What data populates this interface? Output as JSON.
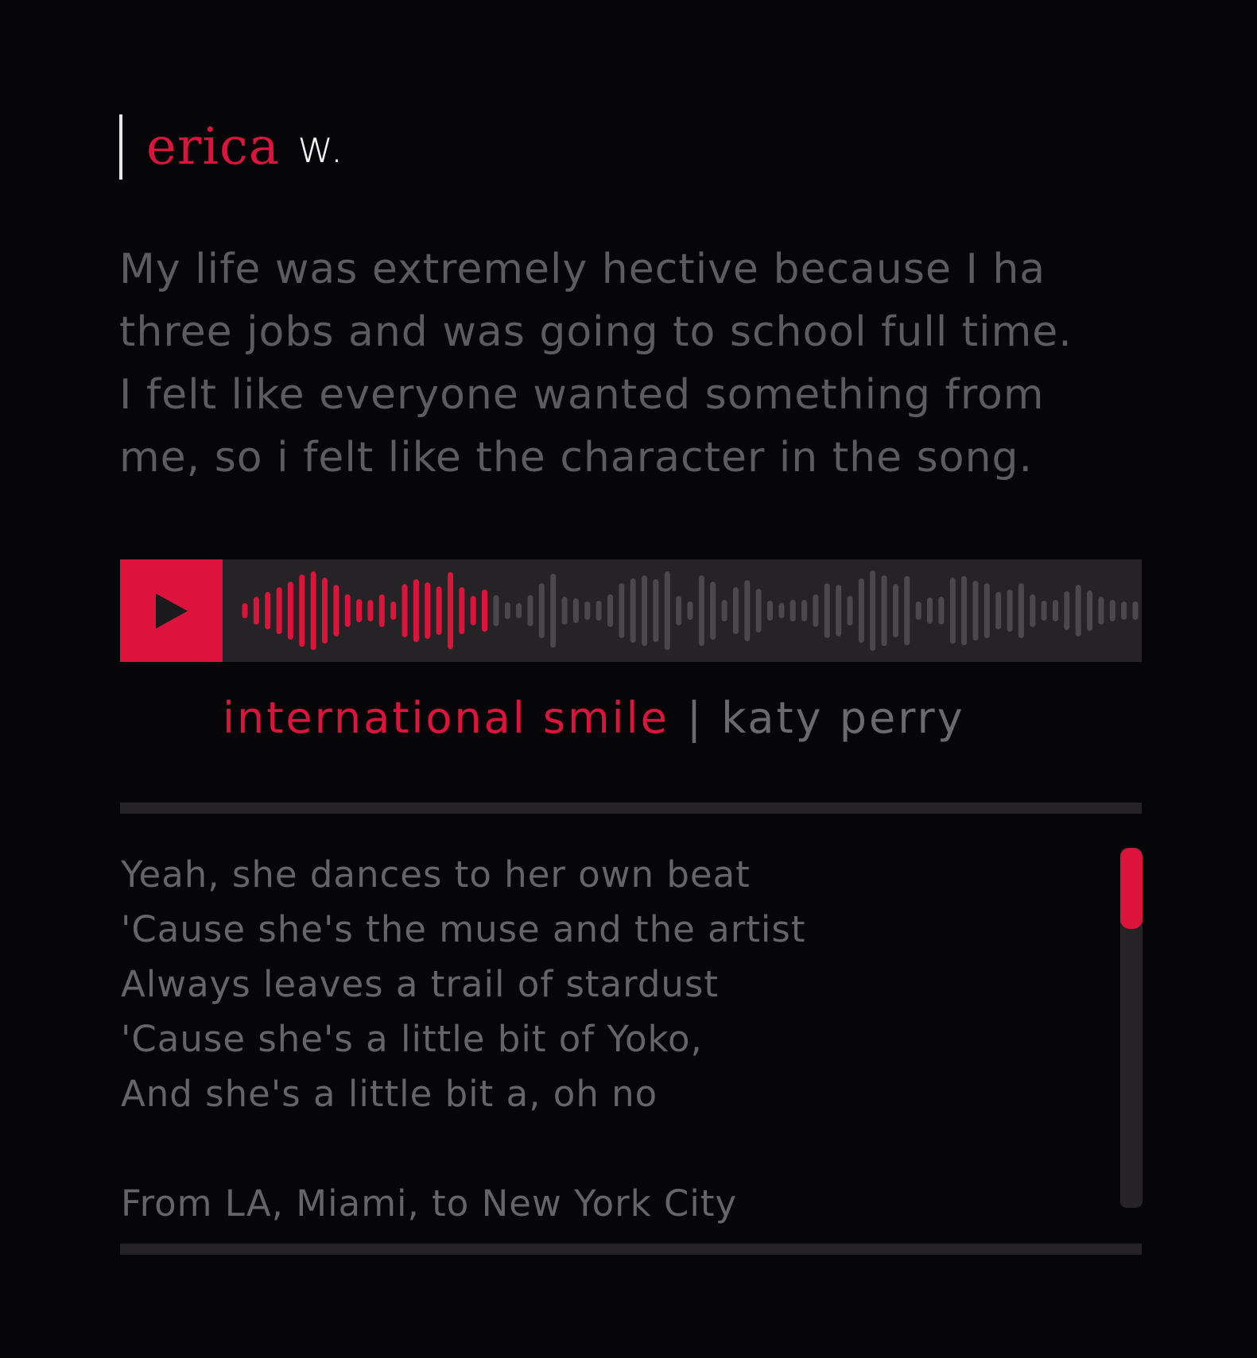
{
  "profile": {
    "first_name": "erica",
    "last_name": "w."
  },
  "story": {
    "lines": [
      "My life was extremely hective because I ha",
      "three jobs and was going to school full time.",
      "I felt like everyone wanted something from",
      "me, so i felt like the character in the song."
    ]
  },
  "player": {
    "play_icon": "play-icon",
    "progress": 0.28,
    "colors": {
      "played": "#dc143c",
      "unplayed": "#4a484b",
      "background": "#252326"
    }
  },
  "song": {
    "title": "international smile",
    "separator": "|",
    "artist": "katy perry"
  },
  "lyrics": {
    "lines": [
      "Yeah, she dances to her own beat",
      "'Cause she's the muse and the artist",
      "Always leaves a trail of stardust",
      "'Cause she's a little bit of Yoko,",
      "And she's a little bit a, oh no",
      "",
      "From LA, Miami, to New York City"
    ],
    "scroll_position": 0
  },
  "colors": {
    "accent": "#dc143c",
    "text_muted": "#5b5b60",
    "background": "#060609",
    "panel": "#252326"
  }
}
